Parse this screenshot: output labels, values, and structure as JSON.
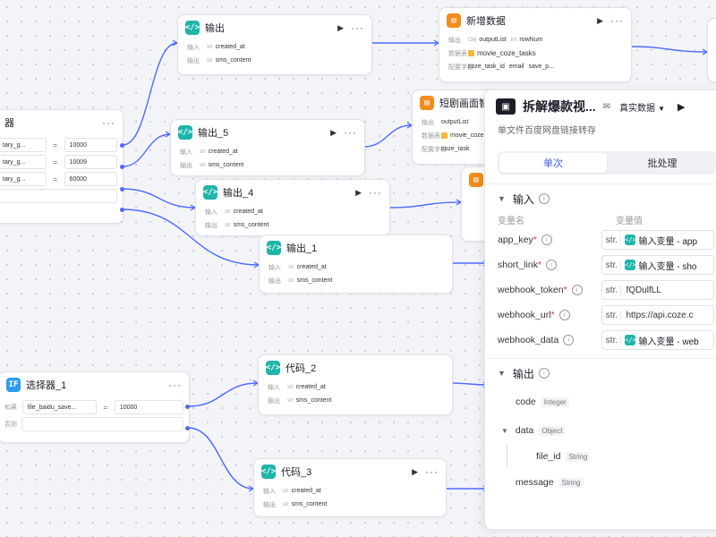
{
  "nodes": {
    "out_top": {
      "title": "输出",
      "r1": {
        "label": "输入",
        "tag": "str",
        "value": "created_at"
      },
      "r2": {
        "label": "输出",
        "tag": "str",
        "value": "sms_content"
      }
    },
    "add_data": {
      "title": "新增数据",
      "r1": {
        "label": "输出",
        "tag1": "Obj",
        "v1": "outputList",
        "tag2": "Int",
        "v2": "rowNum"
      },
      "r2": {
        "label": "数据表",
        "v": "movie_coze_tasks"
      },
      "r3": {
        "label": "配置字段",
        "v1": "coze_task_id",
        "v2": "email",
        "v3": "save_p..."
      }
    },
    "short_drama": {
      "title": "短剧画面智能",
      "r1": {
        "label": "输出",
        "v": "outputList"
      },
      "r2": {
        "label": "数据表",
        "v": "movie_coze"
      },
      "r3": {
        "label": "配置字段",
        "v": "coze_task"
      }
    },
    "out5": {
      "title": "输出_5",
      "r1": {
        "label": "输入",
        "tag": "str",
        "value": "created_at"
      },
      "r2": {
        "label": "输出",
        "tag": "str",
        "value": "sms_content"
      }
    },
    "out4": {
      "title": "输出_4",
      "r1": {
        "label": "输入",
        "tag": "str",
        "value": "created_at"
      },
      "r2": {
        "label": "输出",
        "tag": "str",
        "value": "sms_content"
      }
    },
    "out1": {
      "title": "输出_1",
      "r1": {
        "label": "输入",
        "tag": "str",
        "value": "created_at"
      },
      "r2": {
        "label": "输出",
        "tag": "str",
        "value": "sms_content"
      }
    },
    "cond_left": {
      "title": "器",
      "rows": [
        {
          "var": "tary_g...",
          "op": "=",
          "val": "10000"
        },
        {
          "var": "tary_g...",
          "op": "=",
          "val": "10009"
        },
        {
          "var": "tary_g...",
          "op": "=",
          "val": "60000"
        }
      ]
    },
    "selector": {
      "title": "选择器_1",
      "if_label": "如果",
      "var": "file_baidu_save...",
      "op": "=",
      "val": "10000",
      "else_label": "否则"
    },
    "code2": {
      "title": "代码_2",
      "r1": {
        "label": "输入",
        "tag": "str",
        "value": "created_at"
      },
      "r2": {
        "label": "输出",
        "tag": "str",
        "value": "sms_content"
      }
    },
    "code3": {
      "title": "代码_3",
      "r1": {
        "label": "输入",
        "tag": "str",
        "value": "created_at"
      },
      "r2": {
        "label": "输出",
        "tag": "str",
        "value": "sms_content"
      }
    }
  },
  "icons": {
    "run": "▶",
    "more": "···",
    "code": "</>",
    "if": "IF"
  },
  "panel": {
    "title": "拆解爆款视...",
    "env": "真实数据",
    "desc": "单文件百度网盘链接转存",
    "tabs": [
      "单次",
      "批处理"
    ],
    "input": {
      "heading": "输入",
      "col_name": "变量名",
      "col_value": "变量值",
      "params": [
        {
          "name": "app_key",
          "type": "str.",
          "ref": "输入变量 - app"
        },
        {
          "name": "short_link",
          "type": "str.",
          "ref": "输入变量 - sho"
        },
        {
          "name": "webhook_token",
          "type": "str.",
          "value": "fQDulfLL"
        },
        {
          "name": "webhook_url",
          "type": "str.",
          "value": "https://api.coze.c"
        },
        {
          "name": "webhook_data",
          "type": "str.",
          "ref": "输入变量 - web"
        }
      ]
    },
    "output": {
      "heading": "输出",
      "items": [
        {
          "name": "code",
          "type": "Integer"
        },
        {
          "name": "data",
          "type": "Object"
        },
        {
          "name": "file_id",
          "type": "String"
        },
        {
          "name": "message",
          "type": "String"
        }
      ]
    }
  },
  "colors": {
    "accent": "#3d5af1",
    "edge": "#4d6bfe",
    "code_icon": "#1fb5a9",
    "db_icon": "#f28c1a",
    "if_icon": "#2f9bf0"
  }
}
